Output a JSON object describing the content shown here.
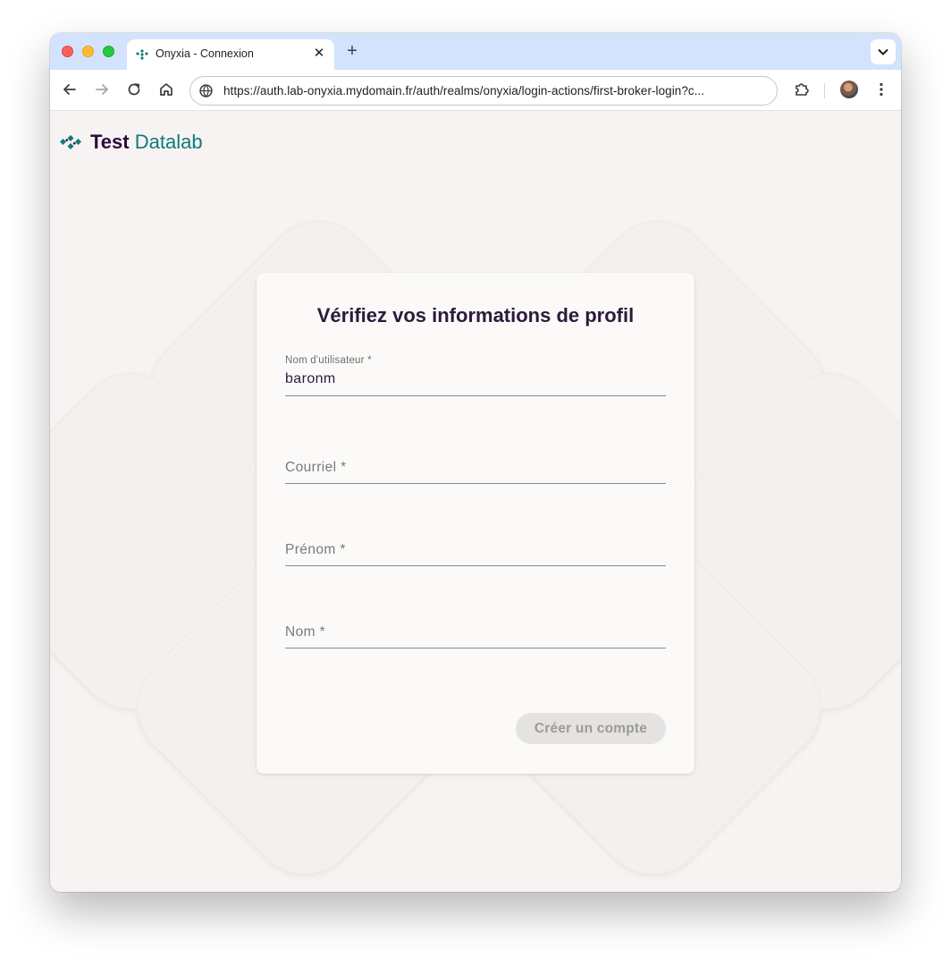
{
  "browser": {
    "tab_title": "Onyxia - Connexion",
    "new_tab_label": "+",
    "tab_close_label": "✕",
    "url": "https://auth.lab-onyxia.mydomain.fr/auth/realms/onyxia/login-actions/first-broker-login?c..."
  },
  "brand": {
    "name_part1": "Test",
    "name_part2": "Datalab",
    "accent": "#0f7a7a",
    "dark": "#2c0b3a"
  },
  "form": {
    "title": "Vérifiez vos informations de profil",
    "fields": [
      {
        "label": "Nom d'utilisateur *",
        "value": "baronm"
      },
      {
        "label": "Courriel *",
        "value": ""
      },
      {
        "label": "Prénom *",
        "value": ""
      },
      {
        "label": "Nom *",
        "value": ""
      }
    ],
    "submit_label": "Créer un compte"
  }
}
